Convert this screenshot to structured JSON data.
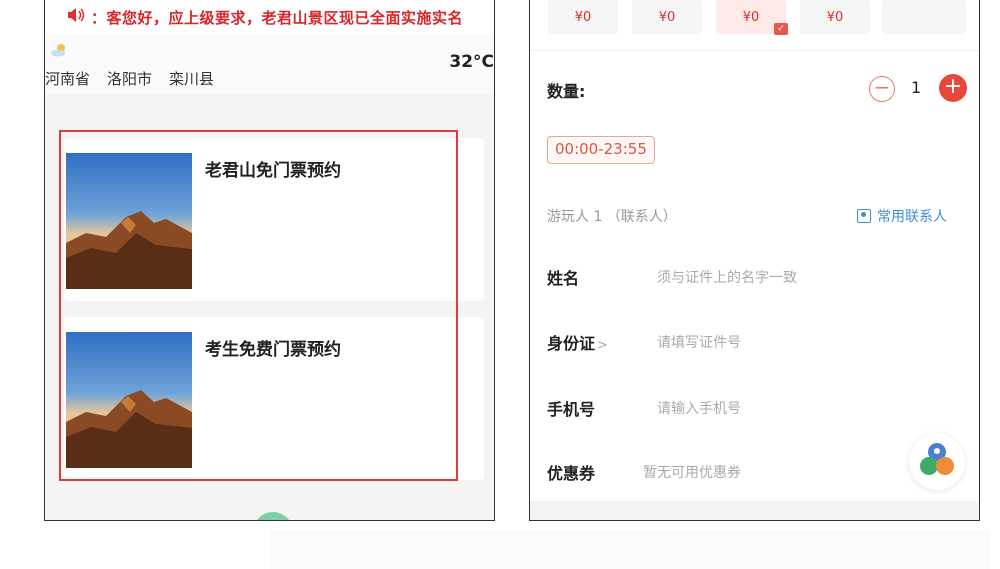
{
  "left_screen": {
    "notice": {
      "icon": "speaker-icon",
      "text": "：客您好，应上级要求，老君山景区现已全面实施实名"
    },
    "weather": {
      "icon": "cloud-sun-icon",
      "temperature": "32°C"
    },
    "regions": [
      "河南省",
      "洛阳市",
      "栾川县"
    ],
    "tickets": [
      {
        "title": "老君山免门票预约",
        "image": "mountain-sunrise-photo"
      },
      {
        "title": "考生免费门票预约",
        "image": "mountain-sunrise-photo"
      }
    ],
    "highlight_color": "#e03a3a"
  },
  "right_screen": {
    "prices": [
      {
        "label": "¥0",
        "selected": false
      },
      {
        "label": "¥0",
        "selected": false
      },
      {
        "label": "¥0",
        "selected": true
      },
      {
        "label": "¥0",
        "selected": false
      },
      {
        "label": "",
        "selected": false
      }
    ],
    "quantity": {
      "label": "数量:",
      "value": "1",
      "minus_icon": "minus-circle-icon",
      "plus_icon": "plus-circle-icon"
    },
    "time_slot": "00:00-23:55",
    "visitor": {
      "label": "游玩人 1 （联系人）",
      "contacts_link": "常用联系人",
      "contacts_icon": "contact-card-icon"
    },
    "form": {
      "name": {
        "label": "姓名",
        "placeholder": "须与证件上的名字一致"
      },
      "id_card": {
        "label": "身份证",
        "chevron": ">",
        "placeholder": "请填写证件号"
      },
      "phone": {
        "label": "手机号",
        "placeholder": "请输入手机号"
      },
      "coupon": {
        "label": "优惠券",
        "placeholder": "暂无可用优惠券"
      }
    },
    "float_button_icon": "colorful-circles-icon",
    "accent_color": "#e8483a",
    "link_color": "#3c8fd8"
  }
}
